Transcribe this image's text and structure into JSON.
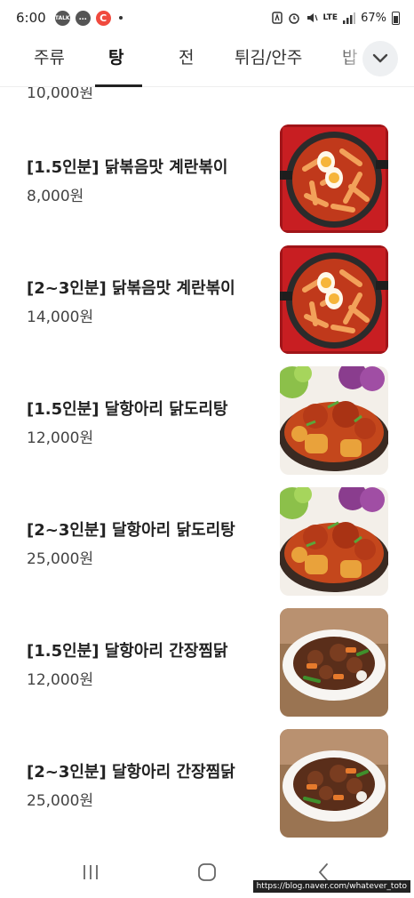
{
  "status_bar": {
    "time": "6:00",
    "notifications": [
      "talk",
      "chat",
      "c-app"
    ],
    "talk_label": "TALK",
    "app_label": "C",
    "network": "LTE",
    "battery": "67%"
  },
  "tabs": [
    {
      "label": "주류",
      "active": false
    },
    {
      "label": "탕",
      "active": true
    },
    {
      "label": "전",
      "active": false
    },
    {
      "label": "튀김/안주",
      "active": false
    },
    {
      "label": "밥",
      "active": false
    }
  ],
  "partial_item_price": "10,000원",
  "menu_items": [
    {
      "name": "[1.5인분] 닭볶음맛 계란볶이",
      "price": "8,000원",
      "image": "tteokbokki-with-eggs"
    },
    {
      "name": "[2~3인분] 닭볶음맛 계란볶이",
      "price": "14,000원",
      "image": "tteokbokki-with-eggs"
    },
    {
      "name": "[1.5인분] 달항아리 닭도리탕",
      "price": "12,000원",
      "image": "spicy-braised-chicken"
    },
    {
      "name": "[2~3인분] 달항아리 닭도리탕",
      "price": "25,000원",
      "image": "spicy-braised-chicken"
    },
    {
      "name": "[1.5인분] 달항아리 간장찜닭",
      "price": "12,000원",
      "image": "soy-braised-chicken"
    },
    {
      "name": "[2~3인분] 달항아리 간장찜닭",
      "price": "25,000원",
      "image": "soy-braised-chicken"
    }
  ],
  "watermark": "https://blog.naver.com/whatever_toto",
  "colors": {
    "accent_dark": "#222222",
    "tab_indicator": "#222222",
    "expand_button_bg": "#eef0f2"
  }
}
